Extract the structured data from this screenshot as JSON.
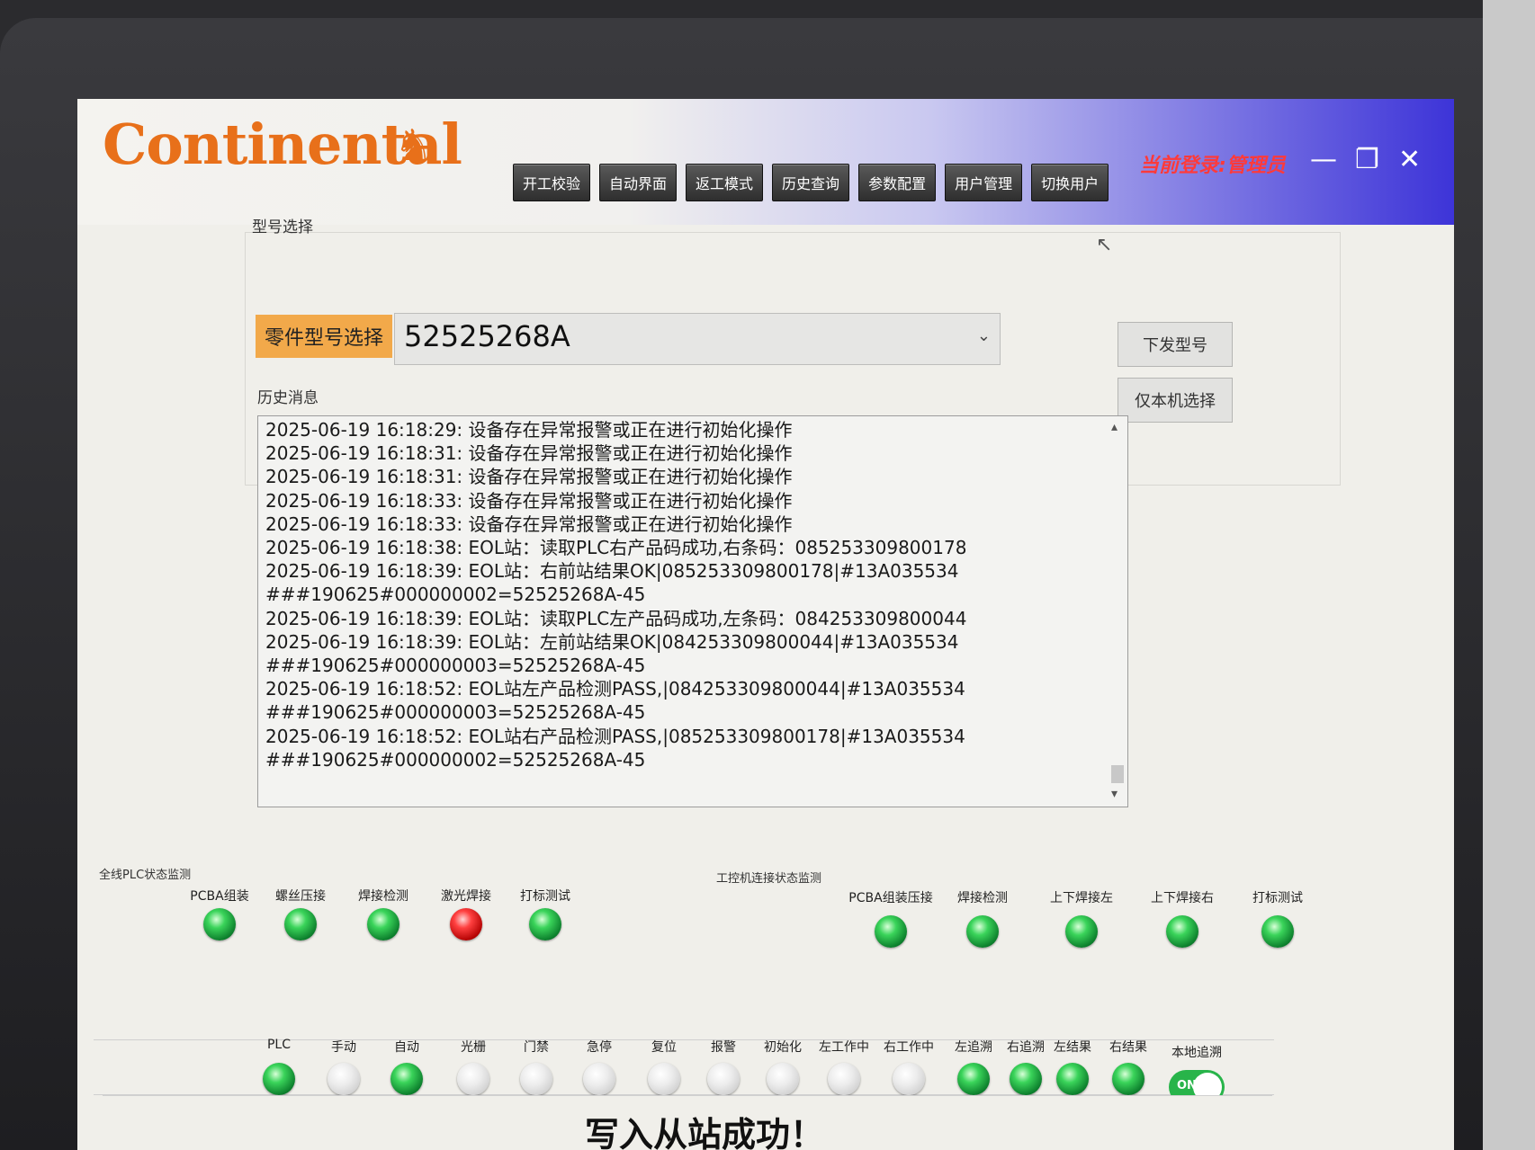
{
  "titlebar": {
    "logo": "Continental",
    "nav": [
      "开工校验",
      "自动界面",
      "返工模式",
      "历史查询",
      "参数配置",
      "用户管理",
      "切换用户"
    ],
    "current_user": "当前登录:管理员",
    "minimize": "—",
    "maximize": "❐",
    "close": "✕"
  },
  "model": {
    "group_title": "型号选择",
    "part_label": "零件型号选择",
    "part_value": "52525268A",
    "download_btn": "下发型号",
    "local_btn": "仅本机选择"
  },
  "log": {
    "title": "历史消息",
    "lines": [
      "2025-06-19 16:18:29:  设备存在异常报警或正在进行初始化操作",
      "2025-06-19 16:18:31:  设备存在异常报警或正在进行初始化操作",
      "2025-06-19 16:18:31:  设备存在异常报警或正在进行初始化操作",
      "2025-06-19 16:18:33:  设备存在异常报警或正在进行初始化操作",
      "2025-06-19 16:18:33:  设备存在异常报警或正在进行初始化操作",
      "2025-06-19 16:18:38:  EOL站：读取PLC右产品码成功,右条码：085253309800178",
      "2025-06-19 16:18:39:  EOL站：右前站结果OK|085253309800178|#13A035534",
      "###190625#000000002=52525268A-45",
      "2025-06-19 16:18:39:  EOL站：读取PLC左产品码成功,左条码：084253309800044",
      "2025-06-19 16:18:39:  EOL站：左前站结果OK|084253309800044|#13A035534",
      "###190625#000000003=52525268A-45",
      "2025-06-19 16:18:52:  EOL站左产品检测PASS,|084253309800044|#13A035534",
      "###190625#000000003=52525268A-45",
      "2025-06-19 16:18:52:  EOL站右产品检测PASS,|085253309800178|#13A035534",
      "###190625#000000002=52525268A-45"
    ]
  },
  "plc_monitor": {
    "title": "全线PLC状态监测",
    "stations": [
      {
        "label": "PCBA组装",
        "state": "green"
      },
      {
        "label": "螺丝压接",
        "state": "green"
      },
      {
        "label": "焊接检测",
        "state": "green"
      },
      {
        "label": "激光焊接",
        "state": "red"
      },
      {
        "label": "打标测试",
        "state": "green"
      }
    ]
  },
  "ipc_monitor": {
    "title": "工控机连接状态监测",
    "stations": [
      {
        "label": "PCBA组装压接",
        "state": "green"
      },
      {
        "label": "焊接检测",
        "state": "green"
      },
      {
        "label": "上下焊接左",
        "state": "green"
      },
      {
        "label": "上下焊接右",
        "state": "green"
      },
      {
        "label": "打标测试",
        "state": "green"
      }
    ]
  },
  "signals": [
    {
      "label": "PLC",
      "state": "green"
    },
    {
      "label": "手动",
      "state": "off"
    },
    {
      "label": "自动",
      "state": "green"
    },
    {
      "label": "光栅",
      "state": "off"
    },
    {
      "label": "门禁",
      "state": "off"
    },
    {
      "label": "急停",
      "state": "off"
    },
    {
      "label": "复位",
      "state": "off"
    },
    {
      "label": "报警",
      "state": "off"
    },
    {
      "label": "初始化",
      "state": "off"
    },
    {
      "label": "左工作中",
      "state": "off"
    },
    {
      "label": "右工作中",
      "state": "off"
    },
    {
      "label": "左追溯",
      "state": "green"
    },
    {
      "label": "右追溯",
      "state": "green"
    },
    {
      "label": "左结果",
      "state": "green"
    },
    {
      "label": "右结果",
      "state": "green"
    }
  ],
  "local_trace": {
    "label": "本地追溯",
    "toggle": "ON"
  },
  "message": "写入从站成功！",
  "colors": {
    "accent": "#3d34d8",
    "logo": "#e8701a",
    "user": "#ff3a3a",
    "ok": "#28b44a",
    "alarm": "#d00000"
  }
}
